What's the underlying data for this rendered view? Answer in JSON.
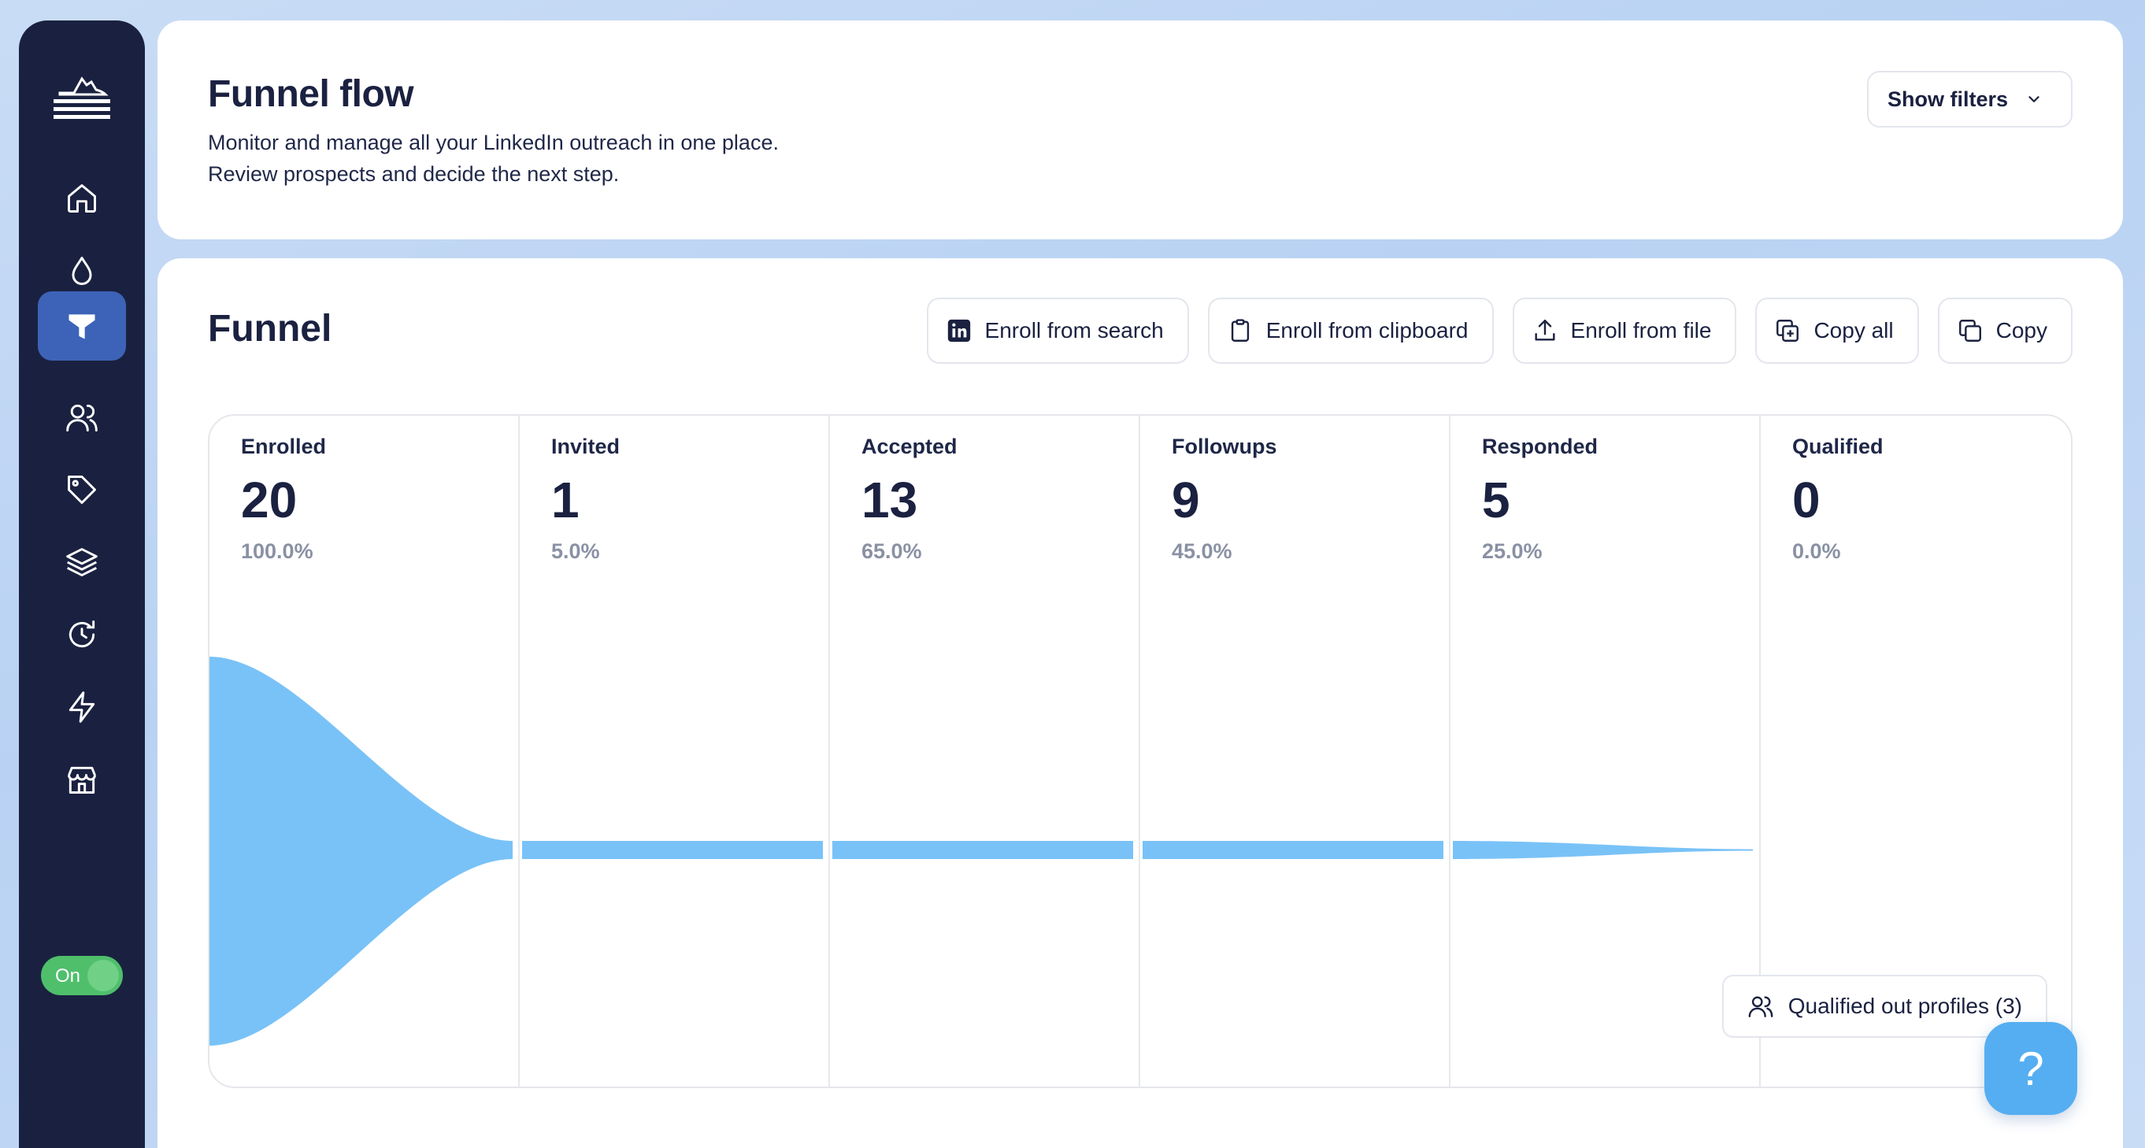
{
  "sidebar": {
    "items": [
      {
        "icon": "home-icon"
      },
      {
        "icon": "drop-icon"
      },
      {
        "icon": "funnel-icon",
        "active": true
      },
      {
        "icon": "users-icon"
      },
      {
        "icon": "tag-icon"
      },
      {
        "icon": "layers-icon"
      },
      {
        "icon": "history-icon"
      },
      {
        "icon": "bolt-icon"
      },
      {
        "icon": "store-icon"
      }
    ],
    "toggle_label": "On"
  },
  "header": {
    "title": "Funnel flow",
    "subtitle_line1": "Monitor and manage all your LinkedIn outreach in one place.",
    "subtitle_line2": "Review prospects and decide the next step.",
    "filter_label": "Show filters"
  },
  "funnel": {
    "title": "Funnel",
    "actions": {
      "enroll_search": "Enroll from search",
      "enroll_clipboard": "Enroll from clipboard",
      "enroll_file": "Enroll from file",
      "copy_all": "Copy all",
      "copy": "Copy"
    },
    "stages": [
      {
        "name": "Enrolled",
        "count": "20",
        "pct": "100.0%"
      },
      {
        "name": "Invited",
        "count": "1",
        "pct": "5.0%"
      },
      {
        "name": "Accepted",
        "count": "13",
        "pct": "65.0%"
      },
      {
        "name": "Followups",
        "count": "9",
        "pct": "45.0%"
      },
      {
        "name": "Responded",
        "count": "5",
        "pct": "25.0%"
      },
      {
        "name": "Qualified",
        "count": "0",
        "pct": "0.0%"
      }
    ],
    "qualified_out_label": "Qualified out profiles (3)"
  },
  "help_label": "?",
  "colors": {
    "sidebar": "#1a2140",
    "active": "#3d63b8",
    "flow": "#79c2f7",
    "toggle": "#4fbf6b",
    "help": "#55aef1"
  }
}
